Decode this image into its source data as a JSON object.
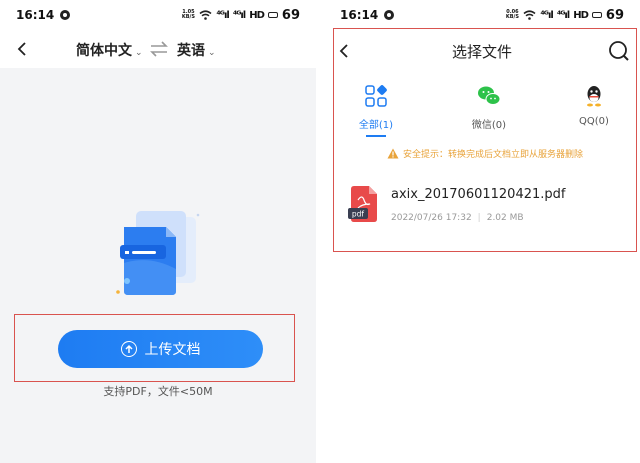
{
  "left": {
    "status": {
      "time": "16:14",
      "speed_top": "1.05",
      "speed_bottom": "KB/S",
      "signal1": "⁴ᴳıl",
      "signal2": "⁴ᴳıl",
      "hd": "HD",
      "battery": "69"
    },
    "header": {
      "source_lang": "简体中文",
      "target_lang": "英语"
    },
    "upload": {
      "label": "上传文档",
      "hint": "支持PDF，文件<50M"
    }
  },
  "right": {
    "status": {
      "time": "16:14",
      "speed_top": "0.06",
      "speed_bottom": "KB/S",
      "signal1": "⁴ᴳıl",
      "signal2": "⁴ᴳıl",
      "hd": "HD",
      "battery": "69"
    },
    "title": "选择文件",
    "tabs": [
      {
        "label": "全部(1)",
        "icon": "grid-icon"
      },
      {
        "label": "微信(0)",
        "icon": "wechat-icon"
      },
      {
        "label": "QQ(0)",
        "icon": "qq-icon"
      }
    ],
    "notice": "安全提示：转换完成后文档立即从服务器删除",
    "file": {
      "name": "axix_20170601120421.pdf",
      "icon_text": "pdf",
      "date": "2022/07/26 17:32",
      "size": "2.02 MB"
    }
  },
  "colors": {
    "accent": "#1e7cf2",
    "highlight_frame": "#d9534f",
    "warning": "#e8a33a",
    "pdf_red": "#e84a4a"
  }
}
